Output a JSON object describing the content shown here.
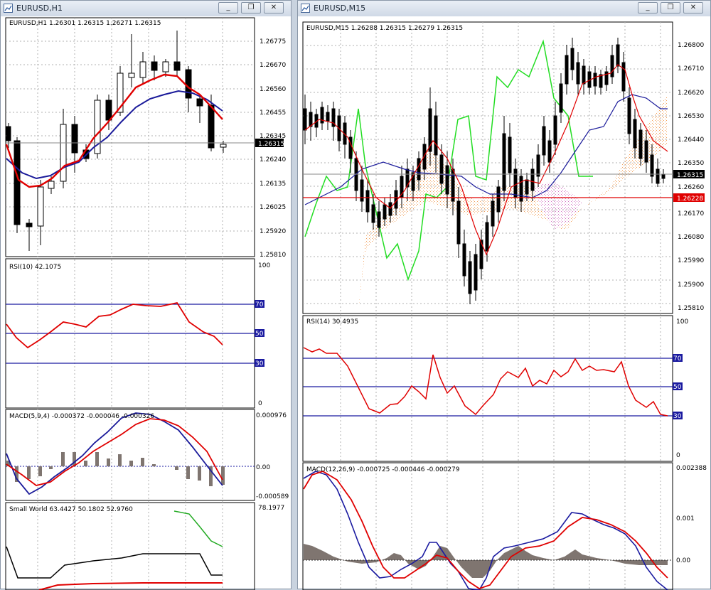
{
  "windows": {
    "left": {
      "title": "EURUSD,H1",
      "main": {
        "header": "EURUSD,H1  1.26301 1.26315 1.26271 1.26315",
        "price_levels": [
          "1.26775",
          "1.26670",
          "1.26560",
          "1.26455",
          "1.26345",
          "1.26240",
          "1.26135",
          "1.26025",
          "1.25920",
          "1.25810"
        ],
        "current_price": "1.26315"
      },
      "rsi": {
        "label": "RSI(10) 42.1075",
        "scale_top": "100",
        "scale_bottom": "0",
        "levels": [
          "70",
          "50",
          "30"
        ]
      },
      "macd": {
        "label": "MACD(5,9,4) -0.000372 -0.000046 -0.000326",
        "top": "0.000976",
        "zero": "0.00",
        "bottom": "-0.000589"
      },
      "small_world": {
        "label": "Small World 63.4427 50.1802 52.9760",
        "top": "78.1977"
      }
    },
    "right": {
      "title": "EURUSD,M15",
      "main": {
        "header": "EURUSD,M15  1.26288 1.26315 1.26279 1.26315",
        "price_levels": [
          "1.26800",
          "1.26710",
          "1.26620",
          "1.26530",
          "1.26440",
          "1.26350",
          "1.26260",
          "1.26170",
          "1.26080",
          "1.25990",
          "1.25900",
          "1.25810"
        ],
        "current_price": "1.26315",
        "red_line_price": "1.26228"
      },
      "rsi": {
        "label": "RSI(14) 30.4935",
        "scale_top": "100",
        "scale_bottom": "0",
        "levels": [
          "70",
          "50",
          "30"
        ]
      },
      "macd": {
        "label": "MACD(12,26,9) -0.000725 -0.000446 -0.000279",
        "top": "0.002388",
        "mid": "0.001",
        "zero": "0.00"
      }
    }
  },
  "window_buttons": {
    "minimize": "_",
    "restore": "❐",
    "close": "✕"
  },
  "colors": {
    "blue_level": "#1a1aa0",
    "red": "#e00000",
    "green": "#22cc22",
    "navy": "#1a1a9a",
    "hist": "#7f7570",
    "price_box": "#000000",
    "price_box_red": "#e00000"
  }
}
